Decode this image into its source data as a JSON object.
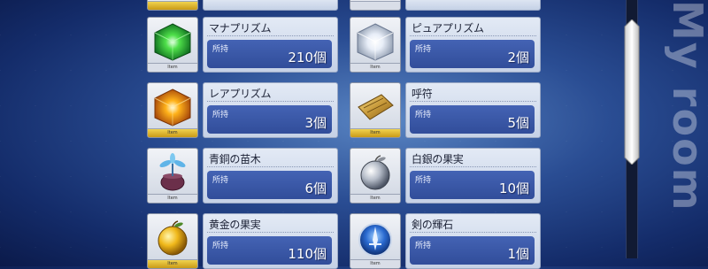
{
  "items": [
    {
      "name": "",
      "stock_label": "",
      "count": "",
      "partial": true,
      "rarity": "gold"
    },
    {
      "name": "",
      "stock_label": "",
      "count": "",
      "partial": true,
      "rarity": "silver"
    },
    {
      "name": "マナプリズム",
      "stock_label": "所持",
      "count": "210個",
      "icon": "green-prism-icon",
      "rarity": "silver"
    },
    {
      "name": "ピュアプリズム",
      "stock_label": "所持",
      "count": "2個",
      "icon": "white-prism-icon",
      "rarity": "silver"
    },
    {
      "name": "レアプリズム",
      "stock_label": "所持",
      "count": "3個",
      "icon": "gold-prism-icon",
      "rarity": "gold"
    },
    {
      "name": "呼符",
      "stock_label": "所持",
      "count": "5個",
      "icon": "summon-ticket-icon",
      "rarity": "gold"
    },
    {
      "name": "青銅の苗木",
      "stock_label": "所持",
      "count": "6個",
      "icon": "bronze-sapling-icon",
      "rarity": "silver"
    },
    {
      "name": "白銀の果実",
      "stock_label": "所持",
      "count": "10個",
      "icon": "silver-apple-icon",
      "rarity": "silver"
    },
    {
      "name": "黄金の果実",
      "stock_label": "所持",
      "count": "110個",
      "icon": "golden-apple-icon",
      "rarity": "gold"
    },
    {
      "name": "剣の輝石",
      "stock_label": "所持",
      "count": "1個",
      "icon": "saber-gem-icon",
      "rarity": "silver"
    }
  ],
  "icon_bar_text": "Item",
  "side_text": "My room",
  "colors": {
    "stock_panel": "#3a58a8",
    "info_panel": "#dde5f2",
    "gold_bar": "#e2b92e"
  }
}
